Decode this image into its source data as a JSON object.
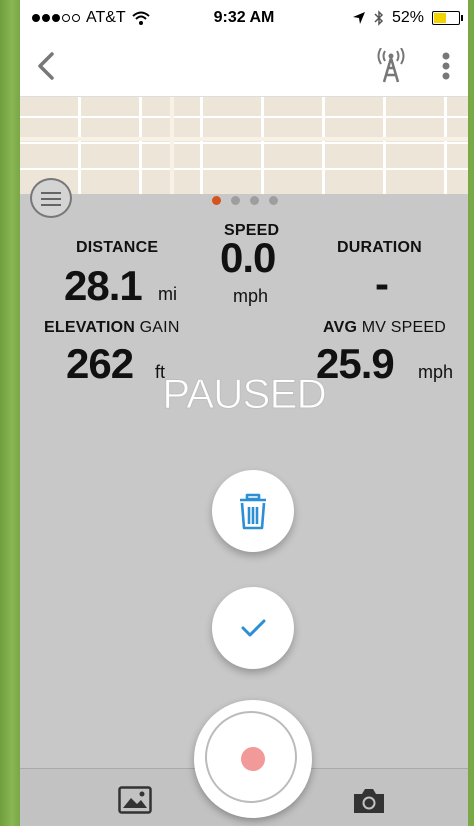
{
  "status": {
    "carrier": "AT&T",
    "time": "9:32 AM",
    "battery": "52%",
    "signal_bars": 3,
    "battery_fraction": 0.52
  },
  "nav": {
    "back_icon": "chevron-left-icon",
    "tower_icon": "antenna-tower-icon",
    "more_icon": "more-vertical-icon"
  },
  "pager": {
    "pages": 4,
    "active": 0,
    "active_color": "#d4541c"
  },
  "stats": {
    "distance": {
      "label": "DISTANCE",
      "value": "28.1",
      "unit": "mi"
    },
    "speed": {
      "label": "SPEED",
      "value": "0.0",
      "unit": "mph"
    },
    "duration": {
      "label": "DURATION",
      "value": "-"
    },
    "elevation": {
      "label_bold": "ELEVATION",
      "label_rest": "GAIN",
      "value": "262",
      "unit": "ft"
    },
    "avg_speed": {
      "label_bold": "AVG",
      "label_rest": "MV SPEED",
      "value": "25.9",
      "unit": "mph"
    }
  },
  "state": "PAUSED",
  "colors": {
    "accent_blue": "#2b8fd6",
    "record_dot": "#f29999",
    "status_battery": "#f2d400"
  }
}
